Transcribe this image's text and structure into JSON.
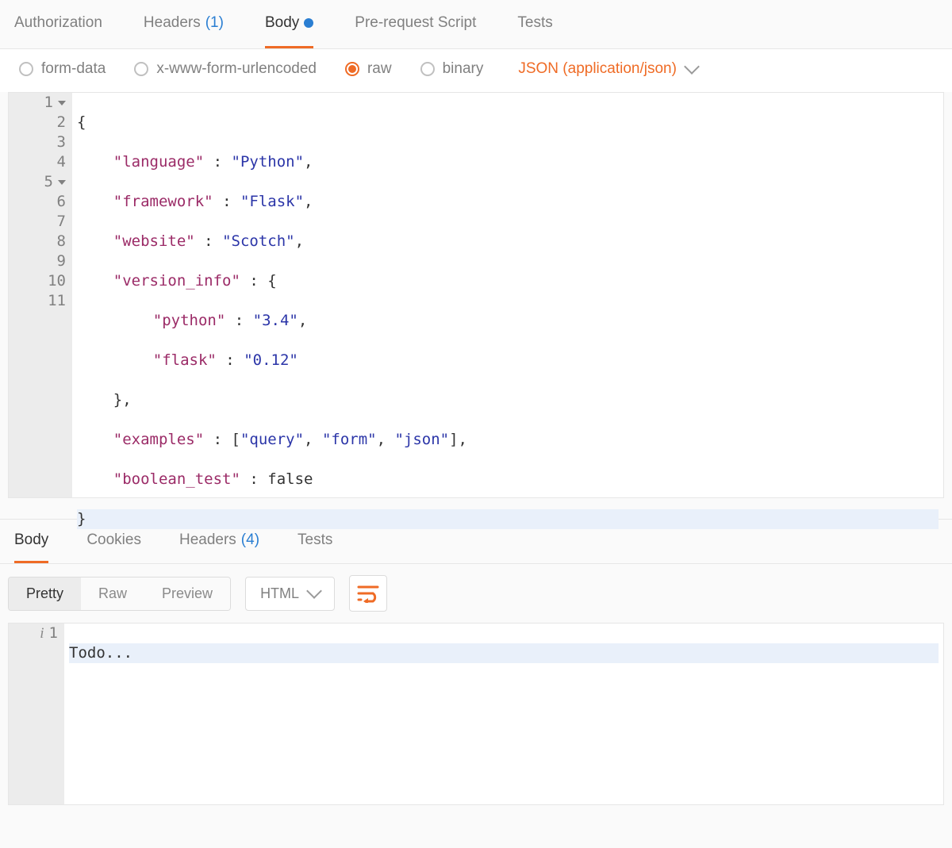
{
  "request_tabs": {
    "authorization": "Authorization",
    "headers_label": "Headers",
    "headers_count": "(1)",
    "body": "Body",
    "prerequest": "Pre-request Script",
    "tests": "Tests"
  },
  "body_types": {
    "form_data": "form-data",
    "urlencoded": "x-www-form-urlencoded",
    "raw": "raw",
    "binary": "binary"
  },
  "content_type_dropdown": "JSON (application/json)",
  "editor": {
    "line_numbers": [
      "1",
      "2",
      "3",
      "4",
      "5",
      "6",
      "7",
      "8",
      "9",
      "10",
      "11"
    ],
    "fold_lines": [
      "1",
      "5"
    ],
    "json_payload": {
      "language": "Python",
      "framework": "Flask",
      "website": "Scotch",
      "version_info": {
        "python": "3.4",
        "flask": "0.12"
      },
      "examples": [
        "query",
        "form",
        "json"
      ],
      "boolean_test": false
    },
    "tokens": {
      "l1": "{",
      "l2_key": "\"language\"",
      "l2_str": "\"Python\"",
      "l3_key": "\"framework\"",
      "l3_str": "\"Flask\"",
      "l4_key": "\"website\"",
      "l4_str": "\"Scotch\"",
      "l5_key": "\"version_info\"",
      "l6_key": "\"python\"",
      "l6_str": "\"3.4\"",
      "l7_key": "\"flask\"",
      "l7_str": "\"0.12\"",
      "l9_key": "\"examples\"",
      "l9_a": "\"query\"",
      "l9_b": "\"form\"",
      "l9_c": "\"json\"",
      "l10_key": "\"boolean_test\"",
      "l10_bool": "false",
      "l11": "}"
    }
  },
  "response_tabs": {
    "body": "Body",
    "cookies": "Cookies",
    "headers_label": "Headers",
    "headers_count": "(4)",
    "tests": "Tests"
  },
  "response_views": {
    "pretty": "Pretty",
    "raw": "Raw",
    "preview": "Preview"
  },
  "response_lang_dd": "HTML",
  "response_body": {
    "line_numbers": [
      "1"
    ],
    "line1": "Todo..."
  }
}
